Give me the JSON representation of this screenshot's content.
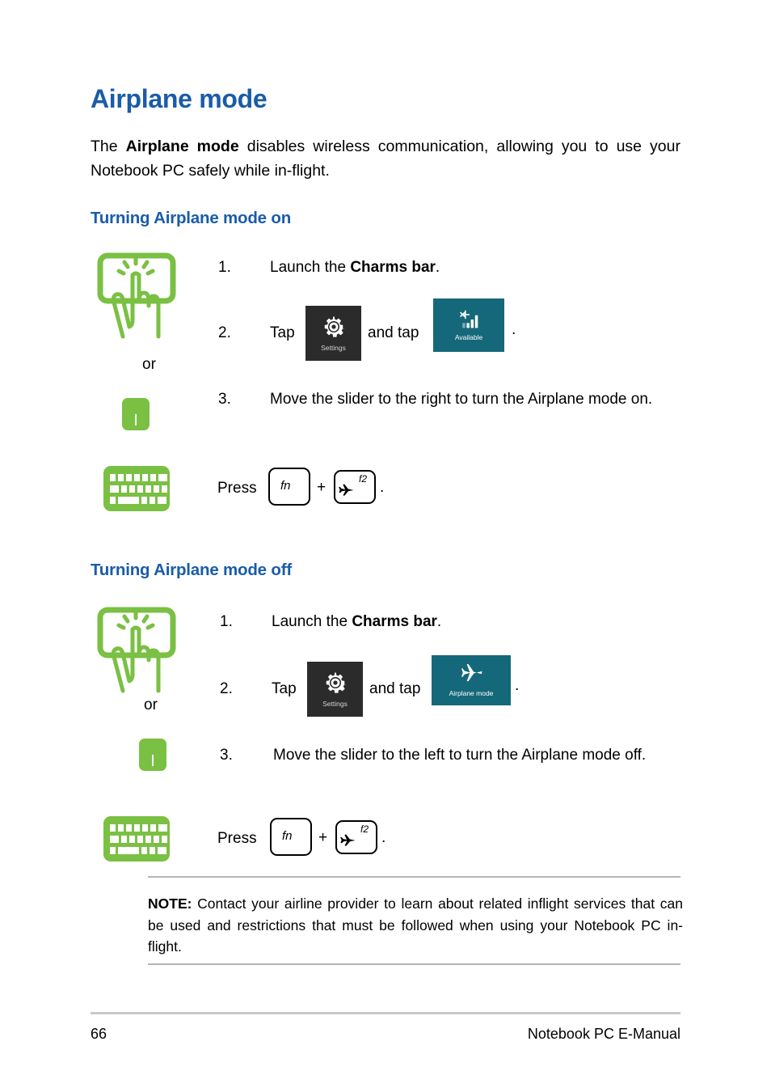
{
  "page": {
    "title": "Airplane mode",
    "intro_before": "The ",
    "intro_bold": "Airplane mode",
    "intro_after": " disables wireless communication, allowing you to use your Notebook PC safely while in-flight."
  },
  "section_on": {
    "heading": "Turning Airplane mode on",
    "or_label": "or",
    "steps": [
      {
        "number": "1.",
        "text_before": "Launch the ",
        "text_bold": "Charms bar",
        "text_after": "."
      },
      {
        "number": "2.",
        "text_before": "Tap ",
        "text_mid": " and tap ",
        "text_after": "."
      },
      {
        "number": "3.",
        "text": "Move the slider to the right to turn the Airplane mode on."
      }
    ],
    "press_label": "Press",
    "key_fn": "fn",
    "key_plus": "+",
    "key_f2": "f2",
    "key_period": ".",
    "tile_settings_label": "Settings",
    "tile_network_label": "Available"
  },
  "section_off": {
    "heading": "Turning Airplane mode off",
    "or_label": "or",
    "steps": [
      {
        "number": "1.",
        "text_before": "Launch the ",
        "text_bold": "Charms bar",
        "text_after": "."
      },
      {
        "number": "2.",
        "text_before": "Tap ",
        "text_mid": " and tap ",
        "text_after": "."
      },
      {
        "number": "3.",
        "text": "Move the slider to the left to turn the Airplane mode off."
      }
    ],
    "press_label": "Press",
    "key_fn": "fn",
    "key_plus": "+",
    "key_f2": "f2",
    "key_period": ".",
    "tile_settings_label": "Settings",
    "tile_airplane_label": "Airplane mode"
  },
  "note": {
    "label": "NOTE:",
    "text": " Contact your airline provider to learn about related inflight services that can be used and restrictions that must be followed when using your Notebook PC in-flight."
  },
  "footer": {
    "page_number": "66",
    "manual_title": "Notebook PC E-Manual"
  },
  "colors": {
    "heading_blue": "#1a5ca8",
    "icon_green": "#7ac043",
    "tile_settings": "#2b2b2b",
    "tile_network": "#14687a",
    "rule_gray": "#c9c9c9"
  }
}
